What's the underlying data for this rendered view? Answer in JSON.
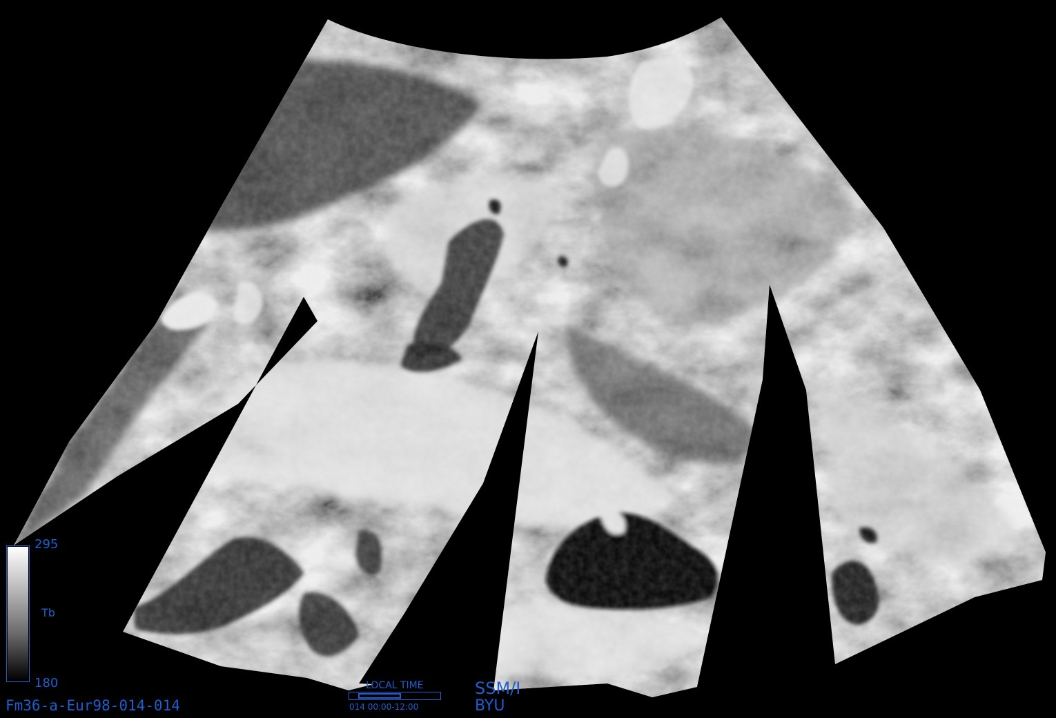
{
  "colors": {
    "background": "#000000",
    "annotation_blue": "#1e5fd0",
    "colorbar_high": "#ffffff",
    "colorbar_low": "#000000"
  },
  "map": {
    "region": "Europe",
    "colorbar": {
      "max_label": "295",
      "min_label": "180",
      "variable_label": "Tb",
      "max_value": 295,
      "min_value": 180,
      "gradient": "white-to-black"
    },
    "product_id": "Fm36-a-Eur98-014-014",
    "local_time": {
      "label": "LOCAL TIME",
      "range": "014  00:00-12:00",
      "fill_fraction_start": 0.1,
      "fill_fraction_end": 0.57
    },
    "sensor_label": "SSM/I",
    "institution_label": "BYU"
  }
}
